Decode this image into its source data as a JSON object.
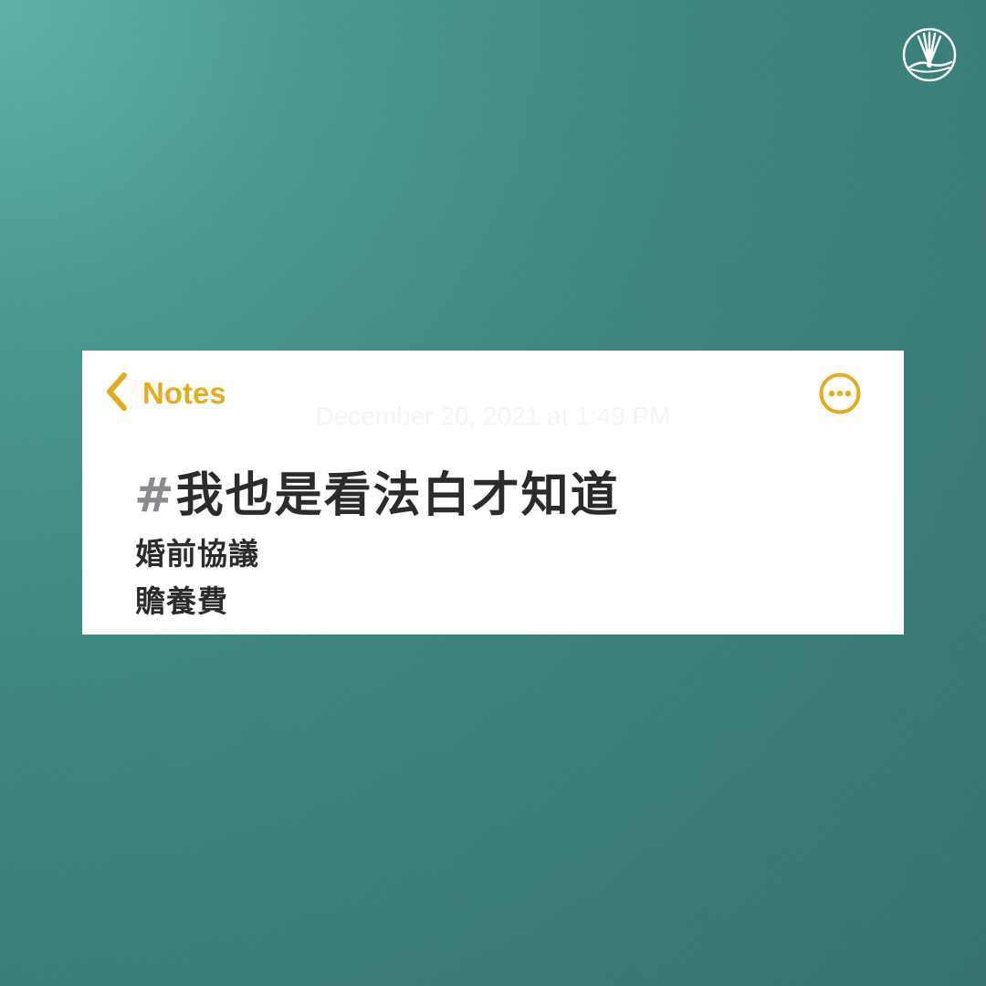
{
  "background": {
    "color_top": "#5fb3a9",
    "color_bottom": "#357370"
  },
  "logo": {
    "icon": "fan-brush-logo-icon"
  },
  "note": {
    "back_label": "Notes",
    "back_icon": "chevron-left-icon",
    "more_icon": "more-ellipsis-icon",
    "accent_color": "#e2ae1f",
    "date": "December 20, 2021 at 1:49 PM",
    "hashtag_symbol": "#",
    "title": "我也是看法白才知道",
    "lines": [
      "婚前協議",
      "贍養費"
    ]
  }
}
